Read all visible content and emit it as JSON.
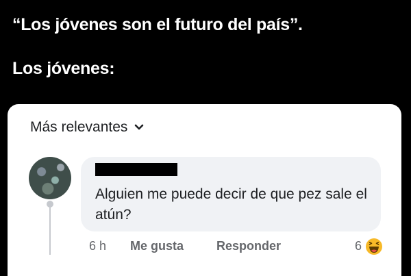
{
  "caption": {
    "line1": "“Los jóvenes son el futuro del país”.",
    "line2": "Los jóvenes:"
  },
  "comments_panel": {
    "sort_label": "Más relevantes",
    "sort_icon": "chevron-down-icon"
  },
  "comment": {
    "author_redacted": true,
    "text": "Alguien me puede decir de que pez sale el atún?",
    "time": "6 h",
    "like_label": "Me gusta",
    "reply_label": "Responder",
    "reaction_count": "6",
    "reaction_icon": "haha-icon"
  },
  "colors": {
    "background": "#000000",
    "card": "#ffffff",
    "bubble": "#f0f2f5",
    "muted_text": "#65676b",
    "reaction": "#f7b928"
  }
}
